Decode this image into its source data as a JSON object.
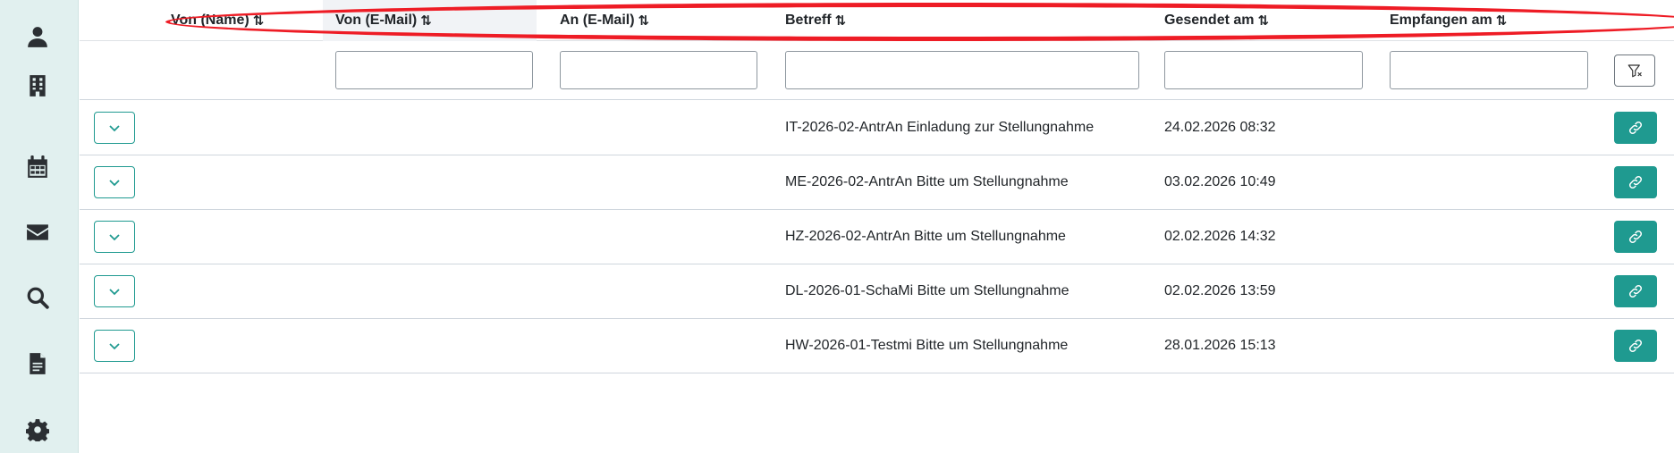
{
  "sidebar": {
    "items": [
      {
        "icon": "user-icon"
      },
      {
        "icon": "building-icon"
      },
      {
        "icon": "calendar-icon"
      },
      {
        "icon": "envelope-icon"
      },
      {
        "icon": "search-icon"
      },
      {
        "icon": "document-icon"
      },
      {
        "icon": "gear-icon"
      }
    ]
  },
  "table": {
    "sort_glyph": "⇅",
    "columns": [
      {
        "label": "Von (Name)"
      },
      {
        "label": "Von (E-Mail)"
      },
      {
        "label": "An (E-Mail)"
      },
      {
        "label": "Betreff"
      },
      {
        "label": "Gesendet am"
      },
      {
        "label": "Empfangen am"
      }
    ],
    "filters": {
      "von_email": "",
      "an_email": "",
      "betreff": "",
      "gesendet_am": "",
      "empfangen_am": ""
    },
    "rows": [
      {
        "betreff": "IT-2026-02-AntrAn Einladung zur Stellungnahme",
        "gesendet_am": "24.02.2026 08:32"
      },
      {
        "betreff": "ME-2026-02-AntrAn Bitte um Stellungnahme",
        "gesendet_am": "03.02.2026 10:49"
      },
      {
        "betreff": "HZ-2026-02-AntrAn Bitte um Stellungnahme",
        "gesendet_am": "02.02.2026 14:32"
      },
      {
        "betreff": "DL-2026-01-SchaMi Bitte um Stellungnahme",
        "gesendet_am": "02.02.2026 13:59"
      },
      {
        "betreff": "HW-2026-01-Testmi Bitte um Stellungnahme",
        "gesendet_am": "28.01.2026 15:13"
      }
    ]
  },
  "colors": {
    "accent": "#1f9a90",
    "annotation": "#ee1c25",
    "sidebar_bg": "#e1f0ef"
  }
}
